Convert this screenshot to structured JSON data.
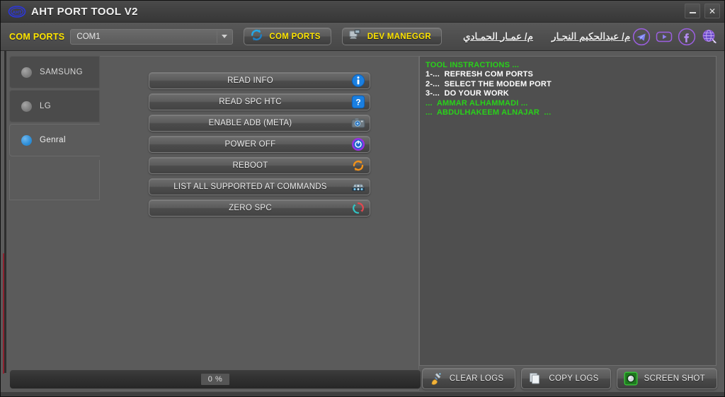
{
  "window": {
    "title": "AHT PORT TOOL V2",
    "logo_icon": "aht-logo-icon",
    "minimize_label": "–",
    "close_label": "✕",
    "minimize_icon": "minimize-icon",
    "close_icon": "close-icon"
  },
  "toolbar": {
    "com_ports_label": "COM PORTS",
    "com_port_selected": "COM1",
    "com_port_placeholder": "COM1",
    "dropdown_icon": "chevron-down-icon",
    "refresh_button": {
      "label": "COM PORTS",
      "icon": "refresh-circular-icon"
    },
    "device_manager_button": {
      "label": "DEV MANEGGR",
      "icon": "device-manager-icon"
    },
    "credit_links": [
      {
        "text": "م/ عمـار الحمـادي"
      },
      {
        "text": "م/ عبدالحكيم النجـار"
      }
    ],
    "socials": [
      {
        "name": "telegram-icon"
      },
      {
        "name": "youtube-icon"
      },
      {
        "name": "facebook-icon"
      },
      {
        "name": "website-search-icon"
      }
    ]
  },
  "sidebar": {
    "items": [
      {
        "label": "SAMSUNG",
        "selected": false
      },
      {
        "label": "LG",
        "selected": false
      },
      {
        "label": "Genral",
        "selected": true
      }
    ]
  },
  "main": {
    "buttons": [
      {
        "label": "READ INFO",
        "icon": "info-icon"
      },
      {
        "label": "READ SPC HTC",
        "icon": "question-icon"
      },
      {
        "label": "ENABLE ADB  (META)",
        "icon": "camera-icon"
      },
      {
        "label": "POWER OFF",
        "icon": "power-icon"
      },
      {
        "label": "REBOOT",
        "icon": "reboot-icon"
      },
      {
        "label": "LIST ALL  SUPPORTED AT COMMANDS",
        "icon": "commands-icon"
      },
      {
        "label": "ZERO SPC",
        "icon": "zero-spc-icon"
      }
    ]
  },
  "log": {
    "lines": [
      {
        "text": "TOOL INSTRACTIONS ...",
        "color": "green"
      },
      {
        "text": "1-...  REFRESH COM PORTS",
        "color": "white"
      },
      {
        "text": "2-...  SELECT THE MODEM PORT",
        "color": "white"
      },
      {
        "text": "3-...  DO YOUR WORK",
        "color": "white"
      },
      {
        "text": "...  AMMAR ALHAMMADI ...",
        "color": "green"
      },
      {
        "text": "...  ABDULHAKEEM ALNAJAR  ...",
        "color": "green"
      }
    ],
    "green_hex": "#29d11a",
    "white_hex": "#ffffff"
  },
  "bottom": {
    "progress_text": "0 %",
    "progress_percent": 0,
    "buttons": [
      {
        "label": "CLEAR LOGS",
        "icon": "broom-icon"
      },
      {
        "label": "COPY LOGS",
        "icon": "copy-icon"
      },
      {
        "label": "SCREEN SHOT",
        "icon": "screenshot-icon"
      }
    ]
  },
  "colors": {
    "accent_yellow": "#ffe500",
    "selected_blue": "#2f8fd8",
    "window_bg": "#5b5b5b",
    "titlebar_bg": "#414141",
    "log_bg": "#4f4f4f",
    "red_strip": "#8e2230"
  }
}
